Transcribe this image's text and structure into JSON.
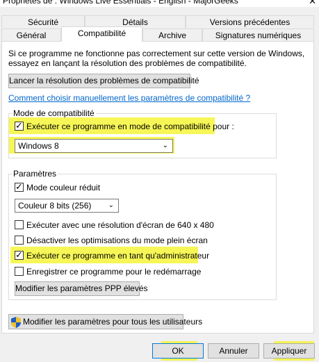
{
  "window": {
    "title": "Propriétés de : Windows Live Essentials - English - MajorGeeks",
    "close_glyph": "✕"
  },
  "tabs_row1": [
    "Sécurité",
    "Détails",
    "Versions précédentes"
  ],
  "tabs_row2": [
    "Général",
    "Compatibilité",
    "Archive",
    "Signatures numériques"
  ],
  "active_tab": "Compatibilité",
  "intro": {
    "line1": "Si ce programme ne fonctionne pas correctement sur cette version de Windows,",
    "line2": "essayez en lançant la résolution des problèmes de compatibilité."
  },
  "troubleshoot_button": "Lancer la résolution des problèmes de compatibilité",
  "manual_link": "Comment choisir manuellement les paramètres de compatibilité ?",
  "compat_mode": {
    "legend": "Mode de compatibilité",
    "checkbox_label": "Exécuter ce programme en mode de compatibilité pour :",
    "checked": true,
    "selected_os": "Windows 8"
  },
  "settings": {
    "legend": "Paramètres",
    "reduced_color_label": "Mode couleur réduit",
    "reduced_color_checked": true,
    "color_select": "Couleur 8 bits (256)",
    "res_label": "Exécuter avec une résolution d'écran de 640 x 480",
    "res_checked": false,
    "fullscreen_label": "Désactiver les optimisations du mode plein écran",
    "fullscreen_checked": false,
    "admin_label": "Exécuter ce programme en tant qu'administrateur",
    "admin_checked": true,
    "restart_label": "Enregistrer ce programme pour le redémarrage",
    "restart_checked": false,
    "dpi_button": "Modifier les paramètres PPP élevés"
  },
  "all_users_button": "Modifier les paramètres pour tous les utilisateurs",
  "footer": {
    "ok": "OK",
    "cancel": "Annuler",
    "apply": "Appliquer"
  },
  "colors": {
    "highlight": "#f5f53a",
    "link": "#0066cc",
    "accent": "#0078d7"
  },
  "icons": {
    "shield": "uac-shield-icon",
    "checkmark": "✓",
    "chevron": "⌄"
  }
}
